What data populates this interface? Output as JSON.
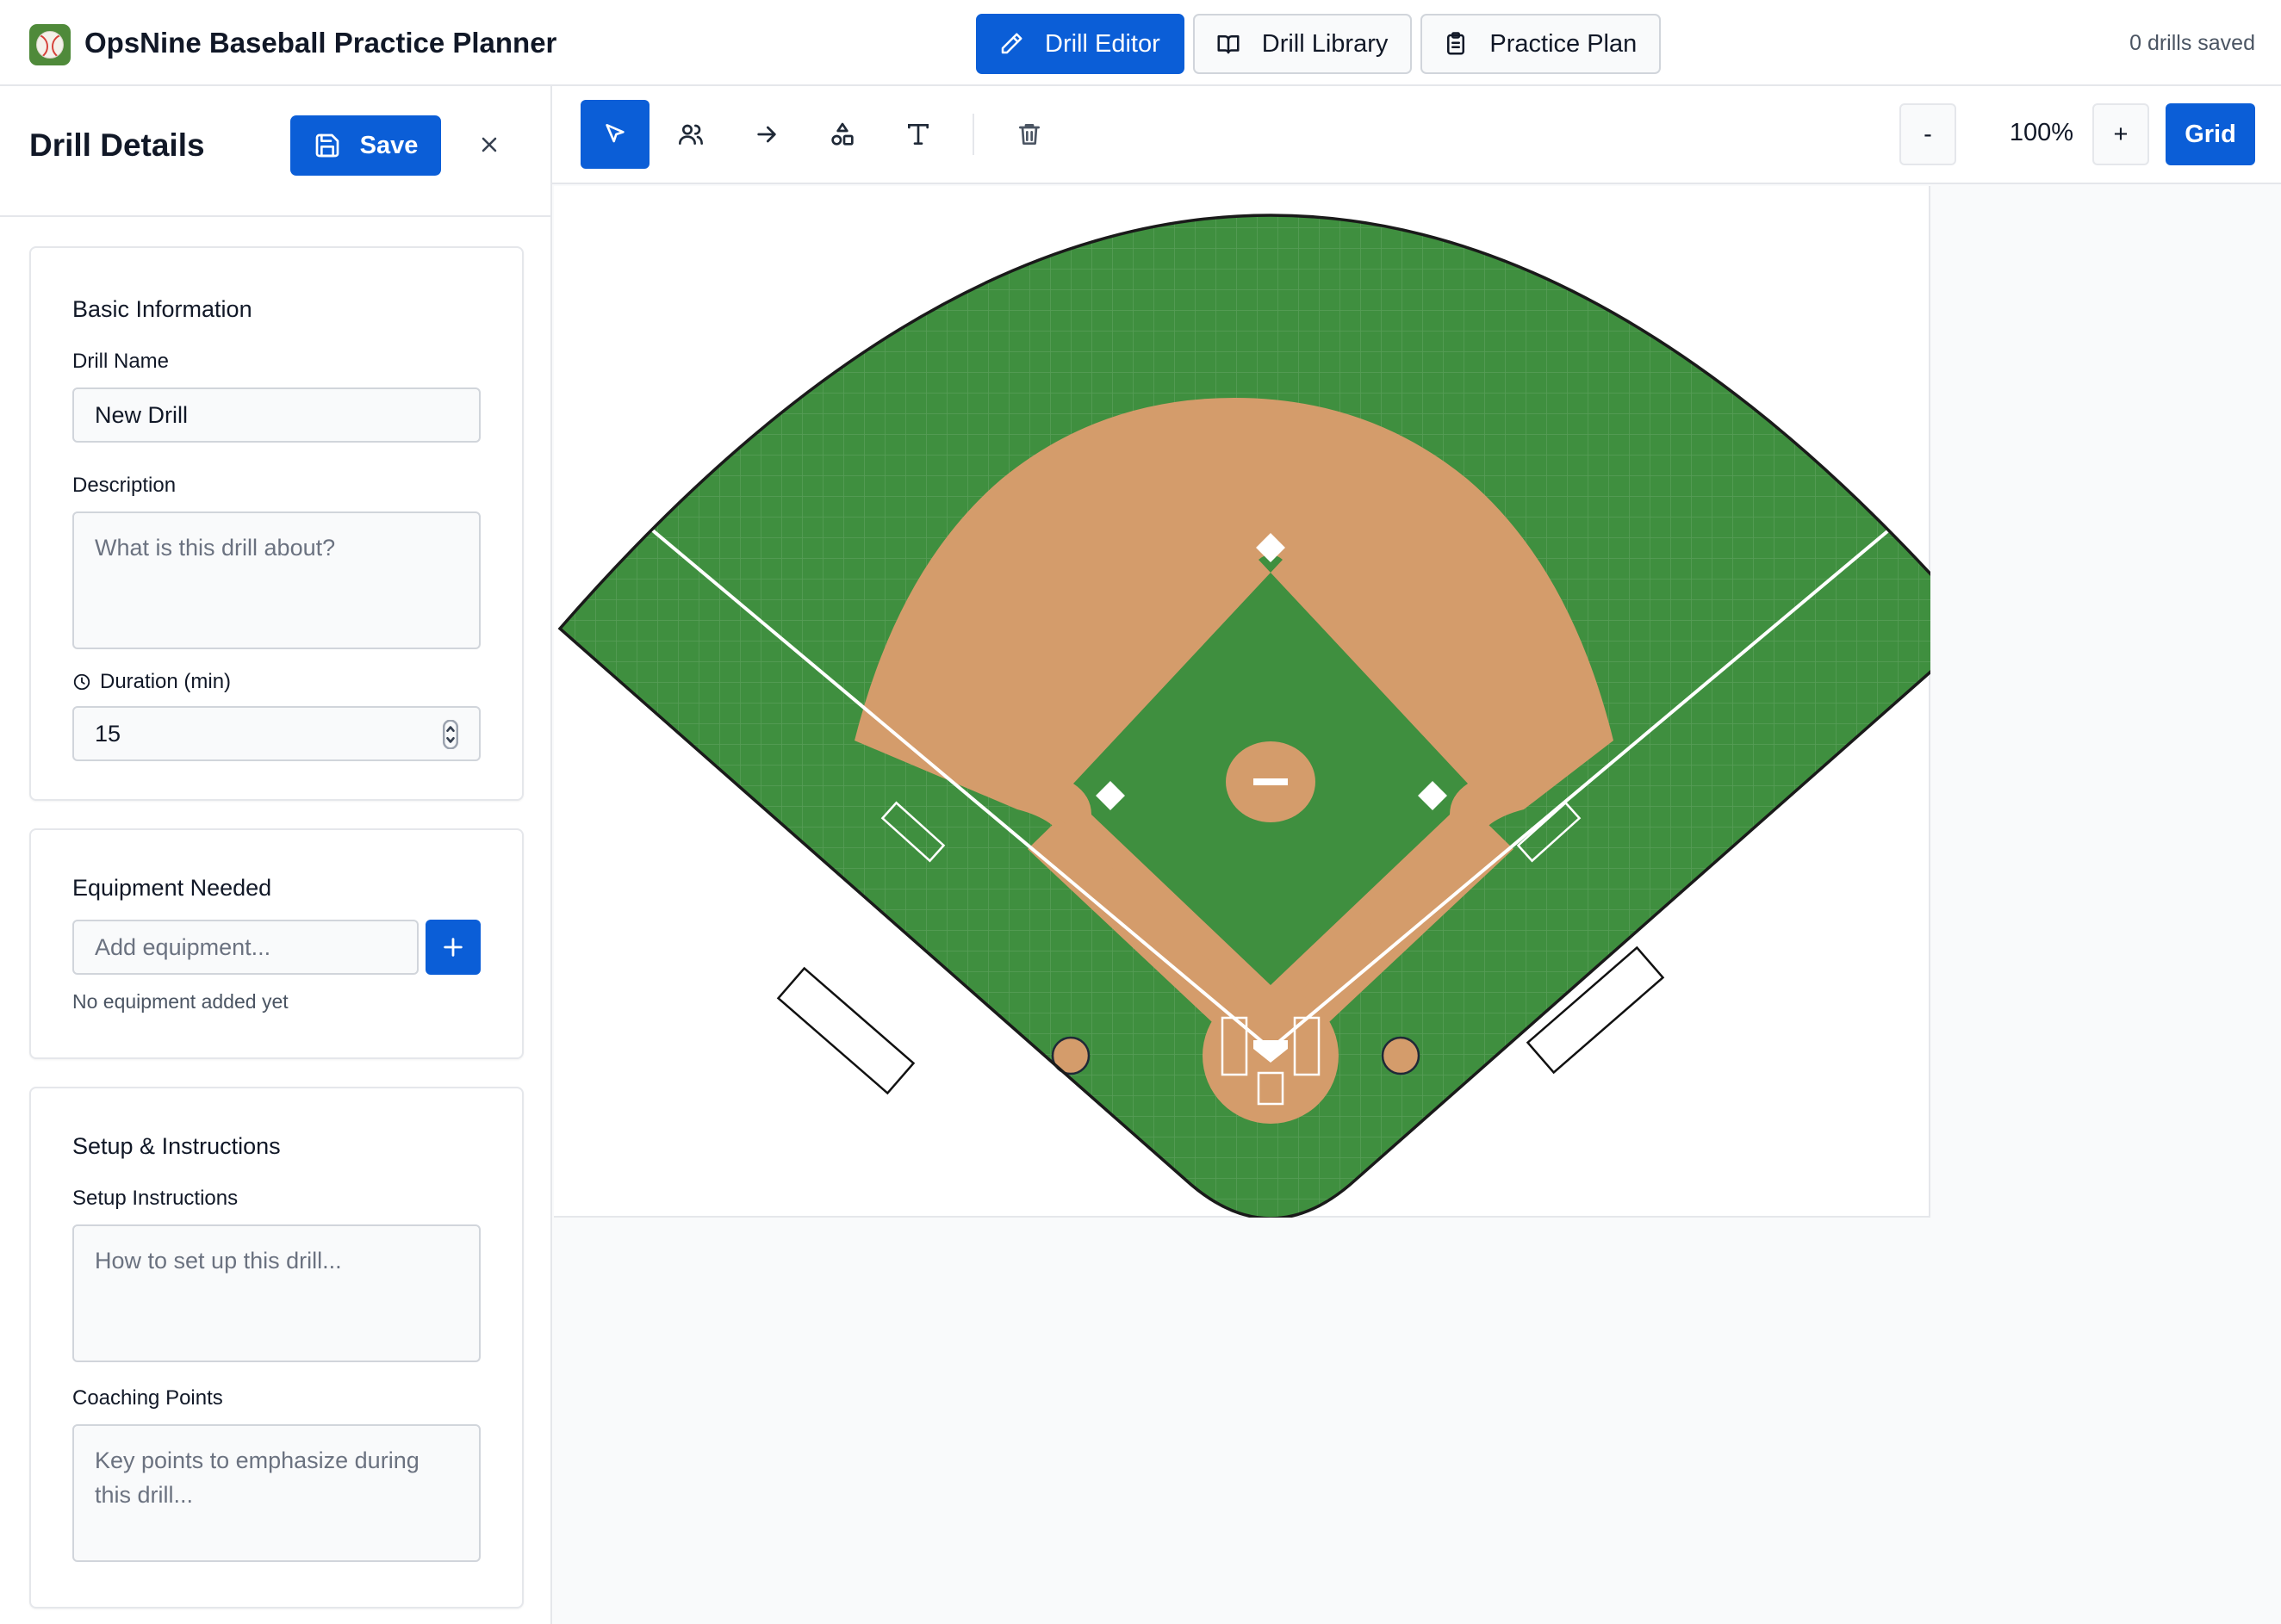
{
  "app": {
    "title": "OpsNine Baseball Practice Planner"
  },
  "nav": {
    "tabs": [
      {
        "label": "Drill Editor",
        "icon": "pencil-icon",
        "active": true
      },
      {
        "label": "Drill Library",
        "icon": "book-icon",
        "active": false
      },
      {
        "label": "Practice Plan",
        "icon": "clipboard-icon",
        "active": false
      }
    ],
    "status": "0 drills saved"
  },
  "sidebar": {
    "title": "Drill Details",
    "save_label": "Save",
    "basic": {
      "title": "Basic Information",
      "name_label": "Drill Name",
      "name_value": "New Drill",
      "description_label": "Description",
      "description_placeholder": "What is this drill about?",
      "duration_label": "Duration (min)",
      "duration_value": "15"
    },
    "equipment": {
      "title": "Equipment Needed",
      "placeholder": "Add equipment...",
      "empty_note": "No equipment added yet"
    },
    "instructions": {
      "title": "Setup & Instructions",
      "setup_label": "Setup Instructions",
      "setup_placeholder": "How to set up this drill...",
      "coaching_label": "Coaching Points",
      "coaching_placeholder": "Key points to emphasize during this drill..."
    }
  },
  "toolbar": {
    "tools": [
      "select-tool",
      "players-tool",
      "arrow-tool",
      "shapes-tool",
      "text-tool",
      "delete-tool"
    ],
    "zoom_out": "-",
    "zoom_level": "100%",
    "zoom_in": "+",
    "grid_label": "Grid"
  },
  "colors": {
    "accent": "#0b5ed7",
    "grass": "#3f8f3f",
    "dirt": "#d49c6b",
    "lines": "#ffffff"
  }
}
